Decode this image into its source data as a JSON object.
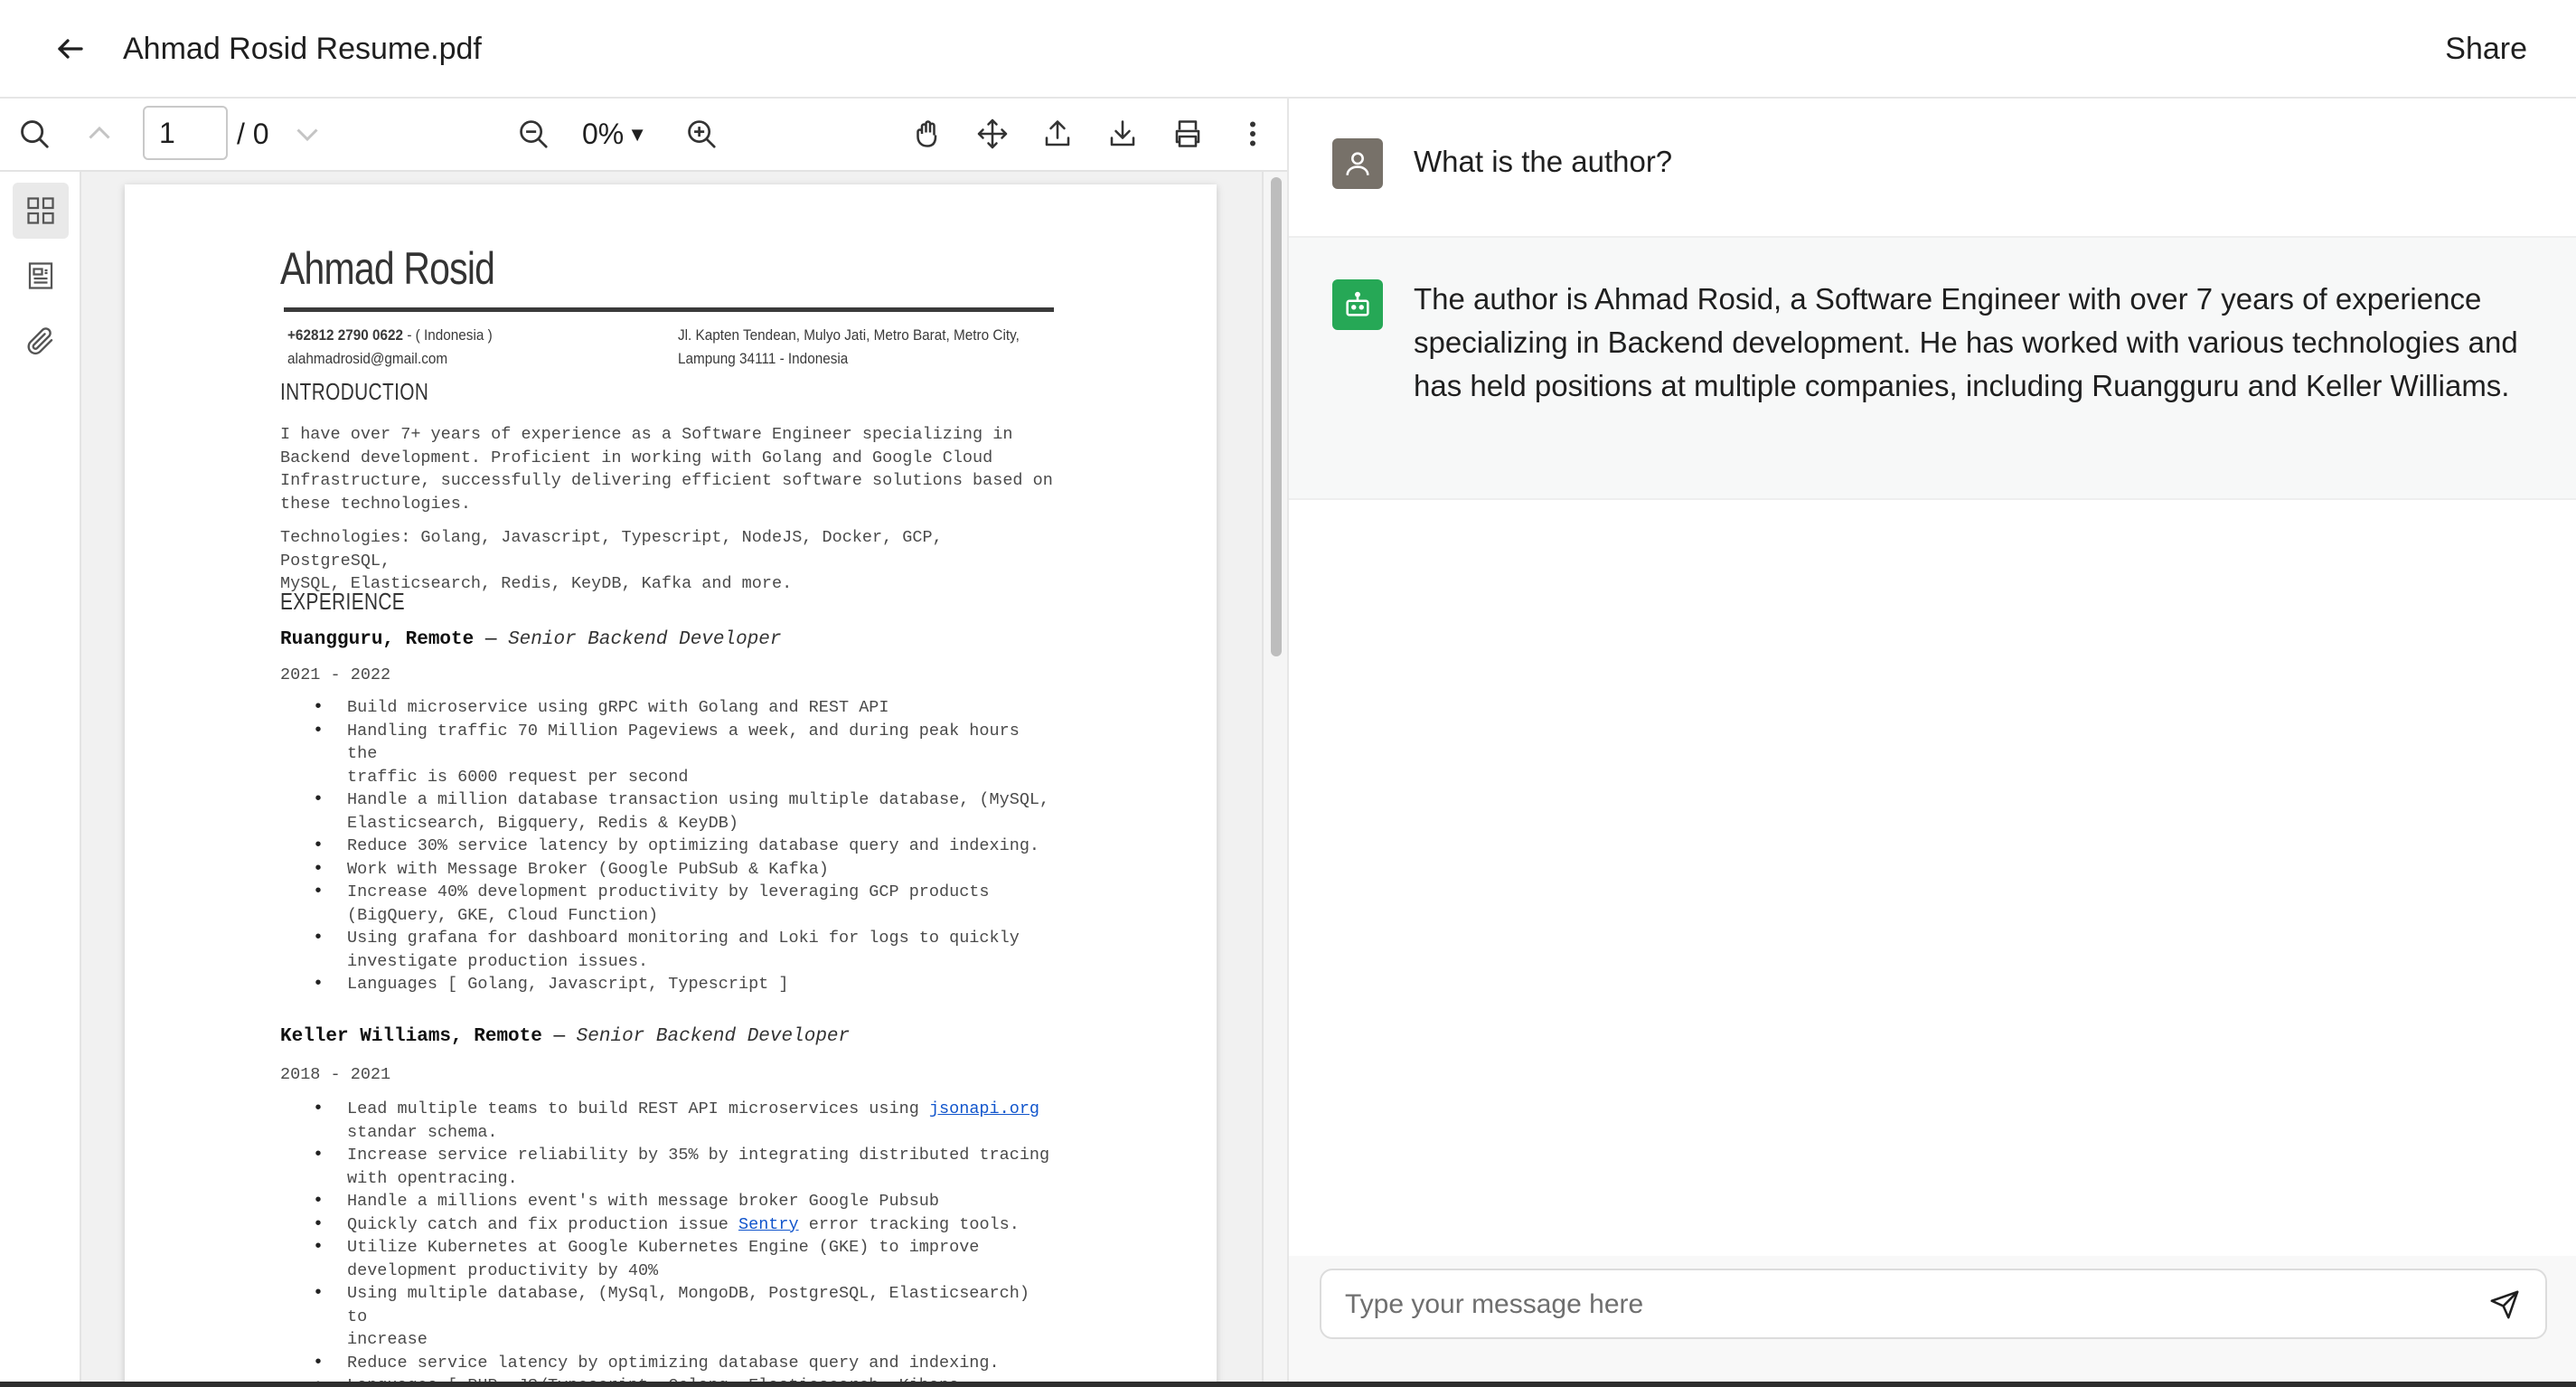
{
  "header": {
    "back_icon": "arrow-left-icon",
    "title": "Ahmad Rosid Resume.pdf",
    "share_label": "Share"
  },
  "viewer": {
    "toolbar": {
      "current_page": "1",
      "total_pages": "/ 0",
      "zoom_level": "0%",
      "zoom_caret": "▼",
      "icons": [
        "search-icon",
        "chevron-up-icon",
        "chevron-down-icon",
        "zoom-out-icon",
        "zoom-in-icon",
        "pan-tool-icon",
        "move-icon",
        "upload-icon",
        "download-icon",
        "print-icon",
        "more-vertical-icon"
      ]
    },
    "rail": {
      "icons": [
        "thumbnails-icon",
        "outline-icon",
        "attachment-icon"
      ],
      "active": "thumbnails-icon"
    },
    "resume": {
      "name": "Ahmad Rosid",
      "phone": "+62812 2790 0622",
      "phone_suffix": " - ( Indonesia )",
      "email": "alahmadrosid@gmail.com",
      "address_line1": "Jl. Kapten Tendean, Mulyo Jati, Metro Barat, Metro City,",
      "address_line2": "Lampung 34111 - Indonesia",
      "intro_heading": "INTRODUCTION",
      "intro_text": "I have over 7+ years of experience as a Software Engineer specializing in\nBackend development. Proficient in working with Golang and Google Cloud\nInfrastructure, successfully delivering efficient software solutions based on\nthese technologies.",
      "tech_text": "Technologies: Golang, Javascript, Typescript, NodeJS, Docker, GCP, PostgreSQL,\nMySQL, Elasticsearch, Redis, KeyDB, Kafka and more.",
      "experience_heading": "EXPERIENCE",
      "jobs": [
        {
          "company": "Ruangguru, Remote",
          "separator": " — ",
          "role": "Senior Backend Developer",
          "dates": "2021 - 2022",
          "bullets": [
            "Build microservice using gRPC with Golang and REST API",
            "Handling traffic 70 Million Pageviews a week, and during peak hours the\ntraffic is 6000 request per second",
            "Handle a million database transaction using multiple database, (MySQL,\nElasticsearch, Bigquery, Redis & KeyDB)",
            "Reduce 30% service latency by optimizing database query and indexing.",
            "Work with Message Broker (Google PubSub & Kafka)",
            "Increase 40% development productivity by leveraging GCP products\n(BigQuery, GKE, Cloud Function)",
            "Using grafana for dashboard monitoring and Loki for logs to quickly\ninvestigate production issues.",
            "Languages [ Golang, Javascript, Typescript ]"
          ]
        },
        {
          "company": "Keller Williams, Remote",
          "separator": " — ",
          "role": "Senior Backend Developer",
          "dates": "2018 - 2021",
          "bullet1_pre": "Lead multiple teams to build REST API microservices using ",
          "bullet1_link": "jsonapi.org",
          "bullet1_post": "\nstandar schema.",
          "bullet2": "Increase service reliability by 35% by integrating distributed tracing\nwith opentracing.",
          "bullet3": "Handle a millions event's with message broker Google Pubsub",
          "bullet4_pre": "Quickly catch and fix production issue ",
          "bullet4_link": "Sentry",
          "bullet4_post": " error tracking tools.",
          "bullet5": "Utilize Kubernetes at Google Kubernetes Engine (GKE) to improve\ndevelopment productivity by 40%",
          "bullet6": "Using multiple database, (MySql, MongoDB, PostgreSQL, Elasticsearch) to\nincrease",
          "bullet7": "Reduce service latency by optimizing database query and indexing.",
          "bullet8": "Languages [ PHP, JS/Typescript, Golang, Elasticsearch, Kibana, Logstash ]"
        }
      ]
    }
  },
  "chat": {
    "messages": [
      {
        "role": "user",
        "avatar_icon": "user-icon",
        "text": "What is the author?"
      },
      {
        "role": "assistant",
        "avatar_icon": "robot-icon",
        "text": "The author is Ahmad Rosid, a Software Engineer with over 7 years of experience specializing in Backend development. He has worked with various technologies and has held positions at multiple companies, including Ruangguru and Keller Williams."
      }
    ],
    "input_placeholder": "Type your message here",
    "send_icon": "send-icon"
  },
  "colors": {
    "user_avatar": "#777169",
    "bot_avatar": "#26a856",
    "link": "#1155cc"
  }
}
